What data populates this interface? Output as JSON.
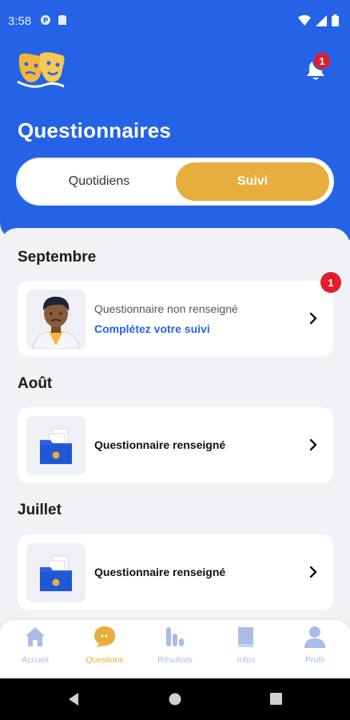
{
  "status_bar": {
    "time": "3:58"
  },
  "header": {
    "title": "Questionnaires",
    "notification_count": "1"
  },
  "tabs": [
    {
      "label": "Quotidiens",
      "active": false
    },
    {
      "label": "Suivi",
      "active": true
    }
  ],
  "sections": [
    {
      "month": "Septembre",
      "title": "Questionnaire non renseigné",
      "subtitle": "Complétez votre suivi",
      "badge": "1",
      "thumb": "doctor-avatar"
    },
    {
      "month": "Août",
      "title": "Questionnaire renseigné",
      "thumb": "folder-icon"
    },
    {
      "month": "Juillet",
      "title": "Questionnaire renseigné",
      "thumb": "folder-icon"
    }
  ],
  "bottom_nav": [
    {
      "label": "Accueil",
      "icon": "home-icon",
      "active": false
    },
    {
      "label": "Questions",
      "icon": "chat-icon",
      "active": true
    },
    {
      "label": "Résultats",
      "icon": "bar-chart-icon",
      "active": false
    },
    {
      "label": "Infos",
      "icon": "book-icon",
      "active": false
    },
    {
      "label": "Profil",
      "icon": "user-icon",
      "active": false
    }
  ],
  "colors": {
    "primary": "#2563e6",
    "accent": "#e7ad3d",
    "badge": "#e11d2e",
    "background": "#f1f2f6"
  }
}
